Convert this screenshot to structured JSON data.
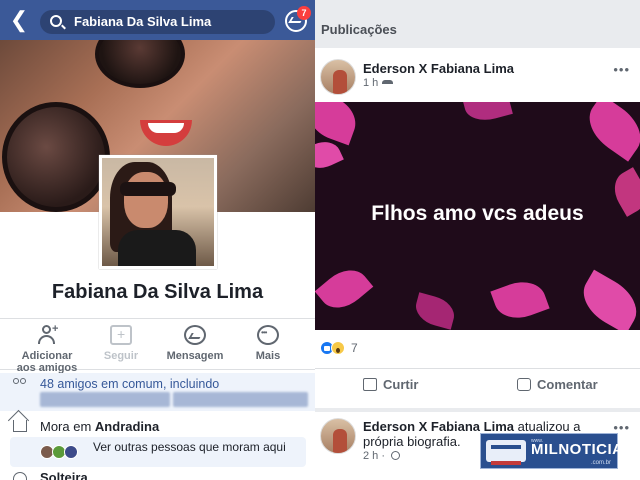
{
  "header": {
    "search_value": "Fabiana Da Silva Lima",
    "messenger_badge": "7"
  },
  "profile": {
    "name": "Fabiana Da Silva Lima"
  },
  "actions": [
    {
      "label": "Adicionar aos amigos",
      "icon": "add-friend-icon",
      "enabled": true
    },
    {
      "label": "Seguir",
      "icon": "follow-icon",
      "enabled": false
    },
    {
      "label": "Mensagem",
      "icon": "messenger-icon",
      "enabled": true
    },
    {
      "label": "Mais",
      "icon": "more-icon",
      "enabled": true
    }
  ],
  "about": {
    "mutual_friends": "48 amigos em comum, incluindo",
    "lives_prefix": "Mora em",
    "lives_city": "Andradina",
    "see_others": "Ver outras pessoas que moram aqui",
    "relationship": "Solteira"
  },
  "feed": {
    "section_title": "Publicações",
    "post1": {
      "author": "Ederson X Fabiana Lima",
      "time": "1 h",
      "image_text": "Flhos amo vcs adeus",
      "reaction_count": "7",
      "like_label": "Curtir",
      "comment_label": "Comentar"
    },
    "post2": {
      "author": "Ederson X Fabiana Lima",
      "text": "atualizou a própria biografia.",
      "time": "2 h"
    }
  },
  "watermark": {
    "brand": "MILNOTICIAS",
    "pre": "www.",
    "domain": ".com.br"
  },
  "colors": {
    "facebook_blue": "#3b5998",
    "link_blue": "#365899",
    "badge_red": "#fa3e3e",
    "post_bg": "#1f0b1a",
    "leaf_pink": "#d63c9a"
  }
}
